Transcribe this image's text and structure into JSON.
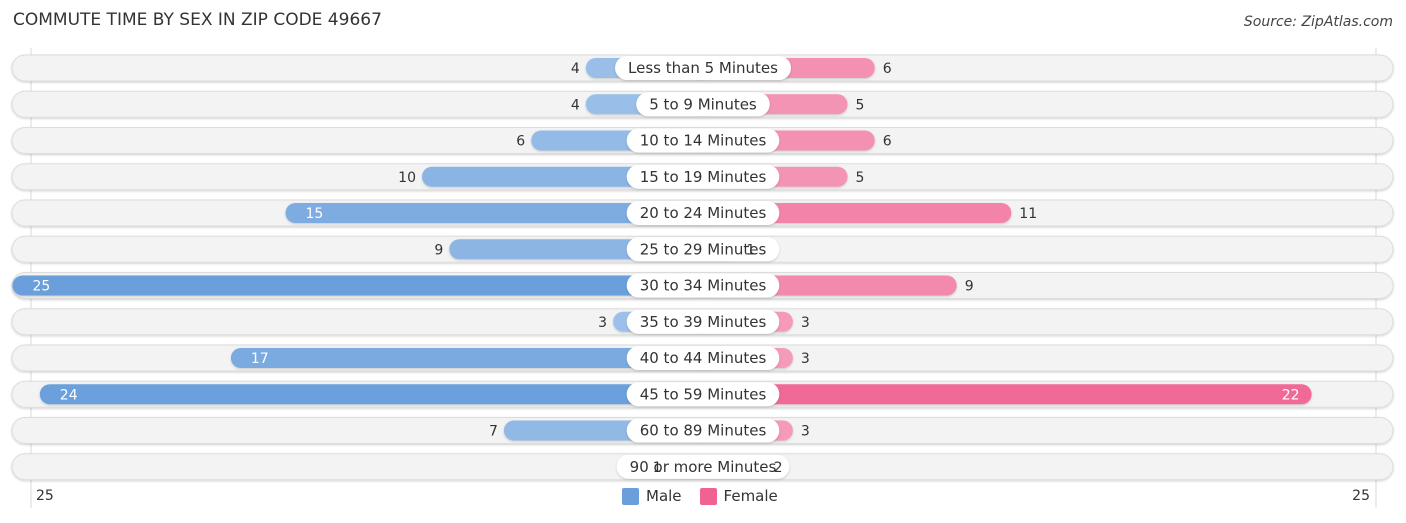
{
  "header": {
    "title": "COMMUTE TIME BY SEX IN ZIP CODE 49667",
    "source": "Source: ZipAtlas.com"
  },
  "colors": {
    "male": "#6a9fdb",
    "male_light": "#a7c7ec",
    "female": "#f06292",
    "female_light": "#f6a7c1",
    "track": "#f3f3f3"
  },
  "chart_data": {
    "type": "bar",
    "orientation": "horizontal-butterfly",
    "title": "COMMUTE TIME BY SEX IN ZIP CODE 49667",
    "categories": [
      "Less than 5 Minutes",
      "5 to 9 Minutes",
      "10 to 14 Minutes",
      "15 to 19 Minutes",
      "20 to 24 Minutes",
      "25 to 29 Minutes",
      "30 to 34 Minutes",
      "35 to 39 Minutes",
      "40 to 44 Minutes",
      "45 to 59 Minutes",
      "60 to 89 Minutes",
      "90 or more Minutes"
    ],
    "series": [
      {
        "name": "Male",
        "values": [
          4,
          4,
          6,
          10,
          15,
          9,
          25,
          3,
          17,
          24,
          7,
          1
        ]
      },
      {
        "name": "Female",
        "values": [
          6,
          5,
          6,
          5,
          11,
          1,
          9,
          3,
          3,
          22,
          3,
          2
        ]
      }
    ],
    "axis": {
      "left_max_label": "25",
      "right_max_label": "25",
      "range": [
        0,
        25
      ]
    },
    "legend": {
      "position": "bottom-center",
      "entries": [
        "Male",
        "Female"
      ]
    },
    "grid": false
  }
}
